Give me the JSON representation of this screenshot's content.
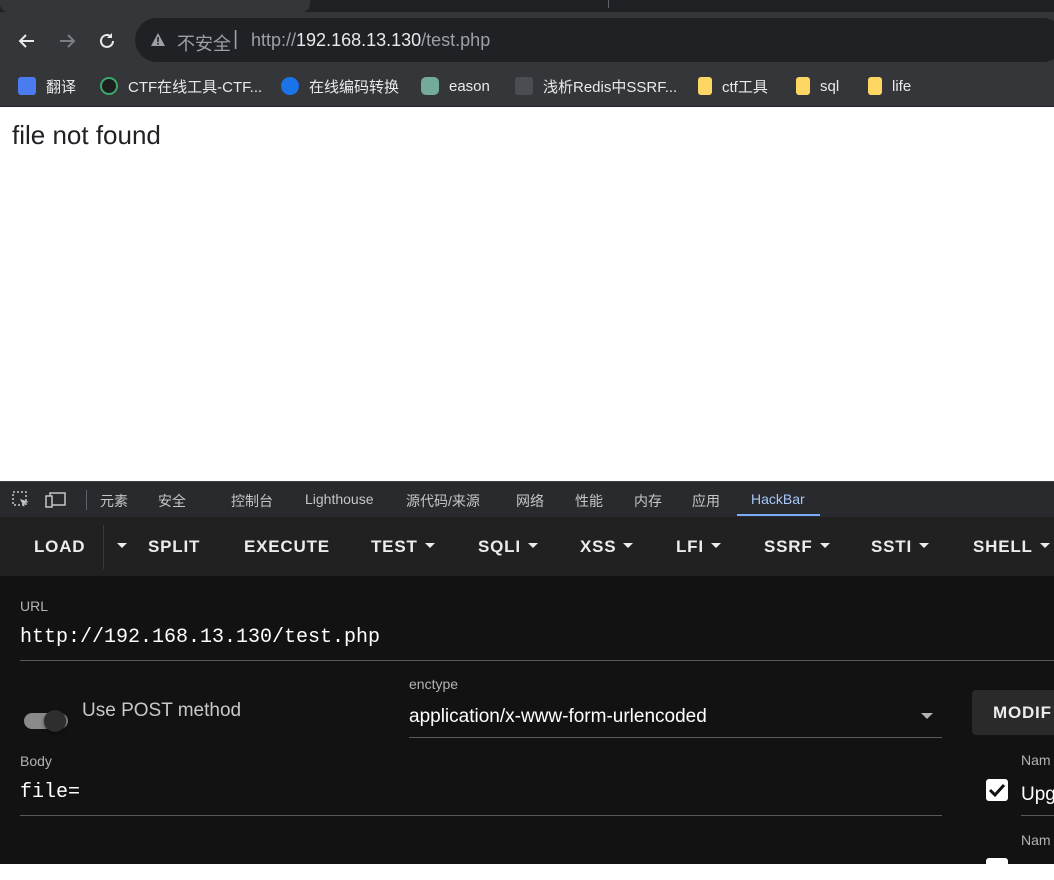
{
  "browser": {
    "insecure_label": "不安全",
    "url_scheme": "http://",
    "url_host": "192.168.13.130",
    "url_path": "/test.php"
  },
  "bookmarks": [
    {
      "label": "翻译",
      "icon": "translate-icon"
    },
    {
      "label": "CTF在线工具-CTF...",
      "icon": "ctf-tools-icon"
    },
    {
      "label": "在线编码转换",
      "icon": "encode-convert-icon"
    },
    {
      "label": "eason",
      "icon": "chatgpt-icon"
    },
    {
      "label": "浅析Redis中SSRF...",
      "icon": "article-icon"
    },
    {
      "label": "ctf工具",
      "icon": "folder-icon"
    },
    {
      "label": "sql",
      "icon": "folder-icon"
    },
    {
      "label": "life",
      "icon": "folder-icon"
    }
  ],
  "page": {
    "message": "file not found"
  },
  "devtools": {
    "tabs": [
      "元素",
      "安全",
      "控制台",
      "Lighthouse",
      "源代码/来源",
      "网络",
      "性能",
      "内存",
      "应用",
      "HackBar"
    ],
    "active_tab": "HackBar"
  },
  "hackbar": {
    "menu": [
      "LOAD",
      "SPLIT",
      "EXECUTE",
      "TEST",
      "SQLI",
      "XSS",
      "LFI",
      "SSRF",
      "SSTI",
      "SHELL"
    ],
    "url_label": "URL",
    "url_value": "http://192.168.13.130/test.php",
    "post_label": "Use POST method",
    "post_enabled": true,
    "enctype_label": "enctype",
    "enctype_value": "application/x-www-form-urlencoded",
    "body_label": "Body",
    "body_value": "file=",
    "modify_label": "MODIF",
    "header_name_label_1": "Nam",
    "header_value_1": "Upg",
    "header_name_label_2": "Nam"
  }
}
